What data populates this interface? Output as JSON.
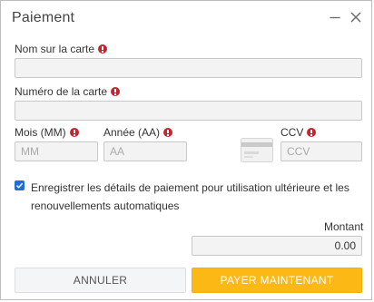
{
  "dialog": {
    "title": "Paiement"
  },
  "form": {
    "card_name_label": "Nom sur la carte",
    "card_name_value": "",
    "card_number_label": "Numéro de la carte",
    "card_number_value": "",
    "month_label": "Mois (MM)",
    "month_placeholder": "MM",
    "year_label": "Année (AA)",
    "year_placeholder": "AA",
    "ccv_label": "CCV",
    "ccv_placeholder": "CCV",
    "save_details_checked": true,
    "save_details_label": "Enregistrer les détails de paiement pour utilisation ultérieure et les renouvellements automatiques",
    "amount_label": "Montant",
    "amount_value": "0.00"
  },
  "buttons": {
    "cancel_label": "ANNULER",
    "pay_label": "PAYER MAINTENANT"
  },
  "colors": {
    "required_icon": "#c1272d",
    "checkbox": "#1e6fd9",
    "pay_button": "#fcb814",
    "cancel_button": "#f4f5f6",
    "field_background": "#f3f3f3"
  },
  "icons": {
    "minimize": "minimize-icon",
    "close": "close-icon",
    "required": "exclamation-circle-icon",
    "card": "credit-card-icon",
    "checkbox": "checkmark-icon"
  }
}
